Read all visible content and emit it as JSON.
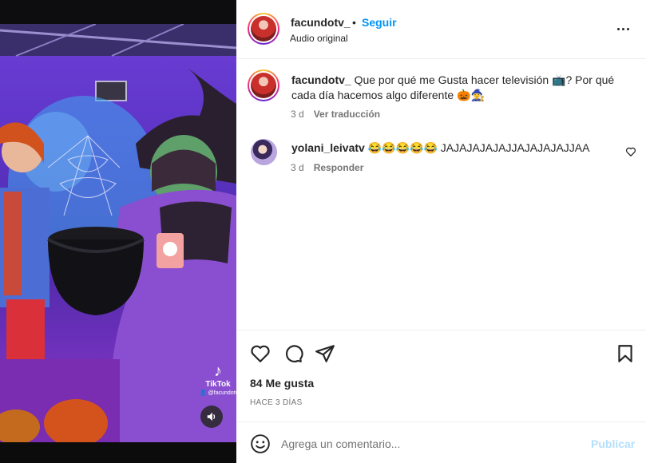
{
  "post": {
    "username": "facundotv_",
    "separator": "•",
    "follow_label": "Seguir",
    "audio_label": "Audio original",
    "caption_text": "Que por qué me Gusta hacer televisión 📺? Por qué cada día hacemos algo diferente 🎃🧙‍♀️",
    "caption_time": "3 d",
    "translate_label": "Ver traducción"
  },
  "comments": [
    {
      "username": "yolani_leivatv",
      "text": "😂😂😂😂😂 JAJAJAJAJAJJAJAJAJAJJAA",
      "time": "3 d",
      "reply_label": "Responder"
    }
  ],
  "media": {
    "tiktok_logo": "♪",
    "tiktok_name": "TikTok",
    "tiktok_handle": "👤 @facundotv"
  },
  "actions": {
    "likes": "84 Me gusta",
    "date": "HACE 3 DÍAS"
  },
  "composer": {
    "placeholder": "Agrega un comentario...",
    "publish_label": "Publicar"
  },
  "colors": {
    "accent": "#0095f6",
    "publish_disabled": "#b2dffc",
    "muted": "#737373"
  }
}
